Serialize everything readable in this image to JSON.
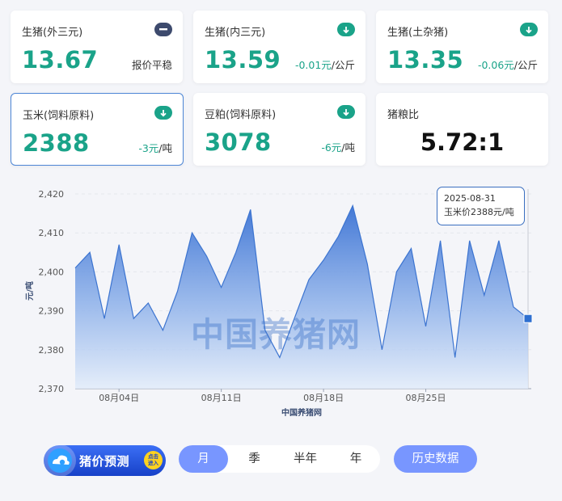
{
  "cards": [
    {
      "name": "生猪(外三元)",
      "value": "13.67",
      "note": "报价平稳",
      "icon": "flat-minus-icon"
    },
    {
      "name": "生猪(内三元)",
      "value": "13.59",
      "delta": "-0.01元",
      "unit": "/公斤",
      "icon": "down-arrow-icon"
    },
    {
      "name": "生猪(土杂猪)",
      "value": "13.35",
      "delta": "-0.06元",
      "unit": "/公斤",
      "icon": "down-arrow-icon"
    },
    {
      "name": "玉米(饲料原料)",
      "value": "2388",
      "delta": "-3元",
      "unit": "/吨",
      "icon": "down-arrow-icon",
      "selected": true
    },
    {
      "name": "豆粕(饲料原料)",
      "value": "3078",
      "delta": "-6元",
      "unit": "/吨",
      "icon": "down-arrow-icon"
    },
    {
      "name": "猪粮比",
      "value": "5.72:1"
    }
  ],
  "colors": {
    "accent_green": "#1aa389",
    "chart_blue": "#3c74d0",
    "button_blue": "#7896ff",
    "neutral_icon": "#3d4a6d"
  },
  "chart_data": {
    "type": "area",
    "ylabel": "元/吨",
    "xlabel": "中国养猪网",
    "ylim": [
      2370,
      2420
    ],
    "y_ticks": [
      "2,420",
      "2,410",
      "2,400",
      "2,390",
      "2,380",
      "2,370"
    ],
    "x_ticks": [
      "08月04日",
      "08月11日",
      "08月18日",
      "08月25日"
    ],
    "watermark": "中国养猪网",
    "x": [
      "08-01",
      "08-02",
      "08-03",
      "08-04",
      "08-05",
      "08-06",
      "08-07",
      "08-08",
      "08-09",
      "08-10",
      "08-11",
      "08-12",
      "08-13",
      "08-14",
      "08-15",
      "08-16",
      "08-17",
      "08-18",
      "08-19",
      "08-20",
      "08-21",
      "08-22",
      "08-23",
      "08-24",
      "08-25",
      "08-26",
      "08-27",
      "08-28",
      "08-29",
      "08-30",
      "08-31"
    ],
    "values": [
      2401,
      2405,
      2388,
      2407,
      2388,
      2392,
      2385,
      2395,
      2410,
      2404,
      2396,
      2405,
      2416,
      2385,
      2378,
      2388,
      2398,
      2403,
      2409,
      2417,
      2402,
      2380,
      2400,
      2406,
      2386,
      2408,
      2378,
      2408,
      2394,
      2408,
      2391,
      2388
    ],
    "tooltip": {
      "date": "2025-08-31",
      "text": "玉米价2388元/吨"
    }
  },
  "promo": {
    "label": "猪价预测",
    "badge_line1": "点击",
    "badge_line2": "进入"
  },
  "tabs": [
    {
      "label": "月",
      "active": true
    },
    {
      "label": "季"
    },
    {
      "label": "半年"
    },
    {
      "label": "年"
    }
  ],
  "history_button": "历史数据"
}
